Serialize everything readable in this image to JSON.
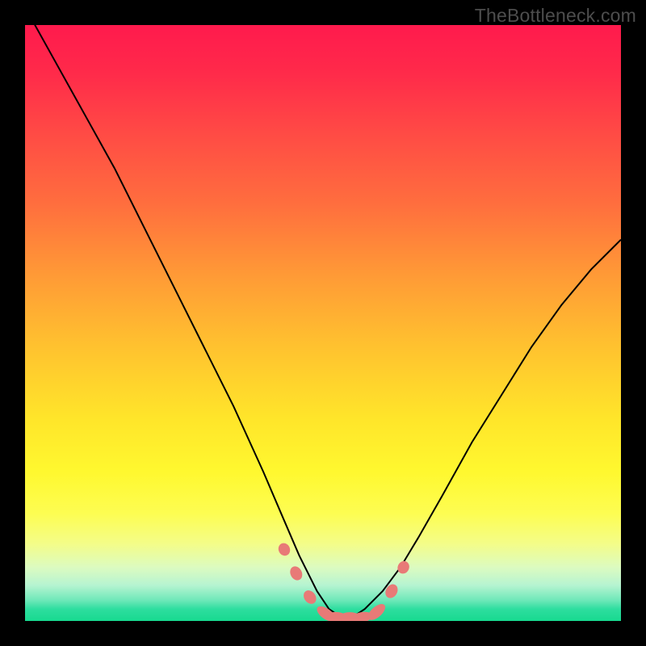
{
  "watermark": "TheBottleneck.com",
  "colors": {
    "frame": "#000000",
    "curve": "#000000",
    "bead": "#e87a77"
  },
  "chart_data": {
    "type": "line",
    "title": "",
    "xlabel": "",
    "ylabel": "",
    "xlim": [
      0,
      100
    ],
    "ylim": [
      0,
      100
    ],
    "grid": false,
    "legend": false,
    "note": "Axes are unlabeled in the image; x and y are normalized 0–100. y represents estimated bottleneck percentage (higher y = higher bottleneck / red zone, y≈0 = green/no bottleneck). Values estimated from curve trajectory.",
    "series": [
      {
        "name": "left-branch",
        "x": [
          0,
          5,
          10,
          15,
          20,
          25,
          30,
          35,
          40,
          43,
          46,
          49,
          51,
          54
        ],
        "y": [
          103,
          94,
          85,
          76,
          66,
          56,
          46,
          36,
          25,
          18,
          11,
          5,
          2,
          0
        ]
      },
      {
        "name": "right-branch",
        "x": [
          54,
          57,
          60,
          63,
          66,
          70,
          75,
          80,
          85,
          90,
          95,
          100
        ],
        "y": [
          0,
          2,
          5,
          9,
          14,
          21,
          30,
          38,
          46,
          53,
          59,
          64
        ]
      }
    ],
    "markers": {
      "name": "beads",
      "note": "Salmon-colored beads on the curve near the minimum",
      "points_xy": [
        [
          43.5,
          12
        ],
        [
          45.5,
          8
        ],
        [
          47.8,
          4
        ],
        [
          50.5,
          1.2
        ],
        [
          52.5,
          0.6
        ],
        [
          54.5,
          0.6
        ],
        [
          56.5,
          0.6
        ],
        [
          59,
          1.5
        ],
        [
          61.5,
          5
        ],
        [
          63.5,
          9
        ]
      ]
    },
    "gradient_stops": [
      {
        "pct": 0,
        "color": "#ff1a4d"
      },
      {
        "pct": 50,
        "color": "#ffd22f"
      },
      {
        "pct": 85,
        "color": "#fbfd70"
      },
      {
        "pct": 100,
        "color": "#17d98f"
      }
    ]
  }
}
